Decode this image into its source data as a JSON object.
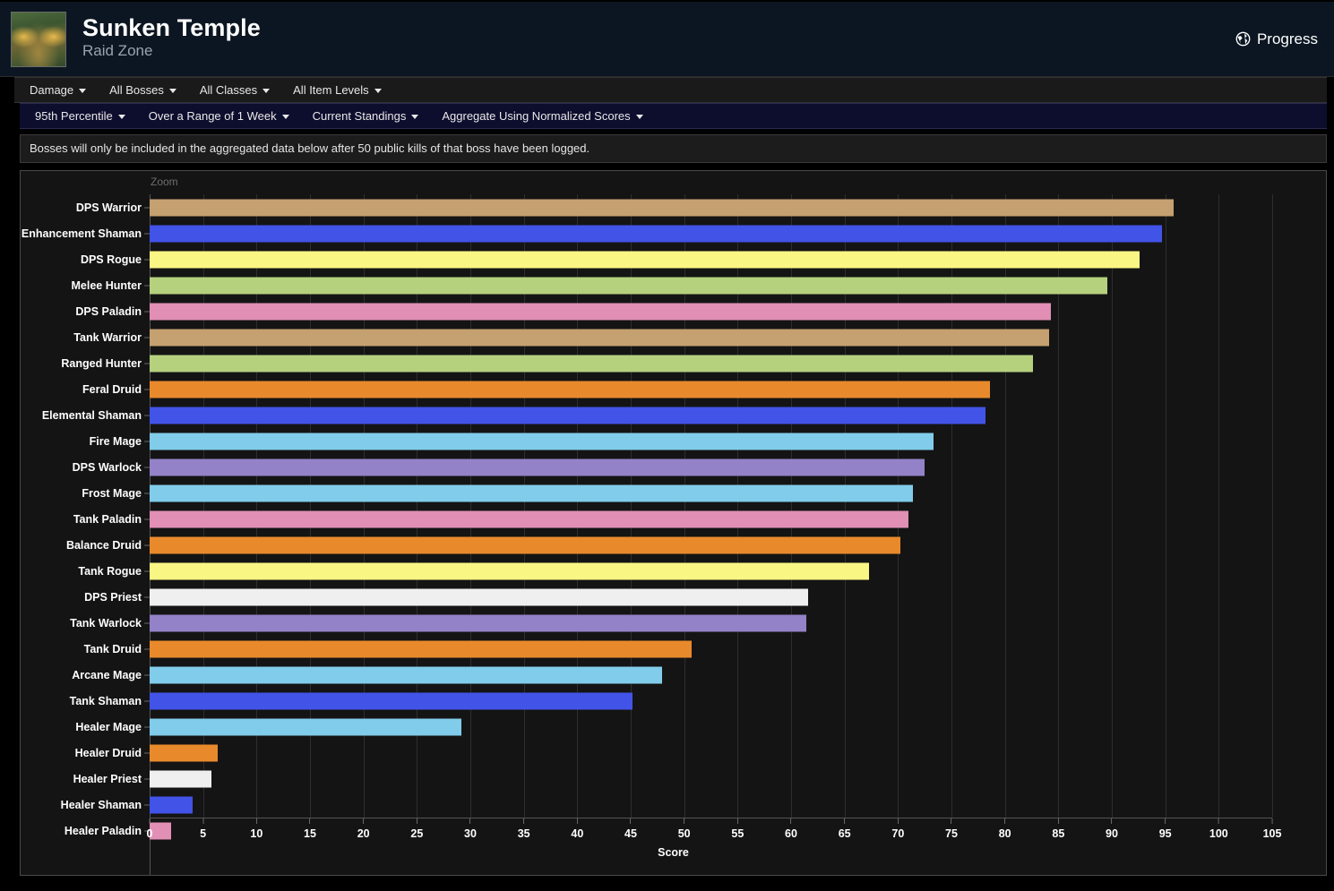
{
  "header": {
    "zone_title": "Sunken Temple",
    "zone_subtitle": "Raid Zone",
    "thumbnail_icon": "raid-zone-thumbnail",
    "progress_label": "Progress",
    "progress_icon": "globe-icon"
  },
  "filters_primary": [
    {
      "label": "Damage",
      "icon": "chevron-down-icon"
    },
    {
      "label": "All Bosses",
      "icon": "chevron-down-icon"
    },
    {
      "label": "All Classes",
      "icon": "chevron-down-icon"
    },
    {
      "label": "All Item Levels",
      "icon": "chevron-down-icon"
    }
  ],
  "filters_secondary": [
    {
      "label": "95th Percentile",
      "icon": "chevron-down-icon"
    },
    {
      "label": "Over a Range of 1 Week",
      "icon": "chevron-down-icon"
    },
    {
      "label": "Current Standings",
      "icon": "chevron-down-icon"
    },
    {
      "label": "Aggregate Using Normalized Scores",
      "icon": "chevron-down-icon"
    }
  ],
  "notice": "Bosses will only be included in the aggregated data below after 50 public kills of that boss have been logged.",
  "chart": {
    "zoom_label": "Zoom"
  },
  "chart_data": {
    "type": "bar",
    "orientation": "horizontal",
    "title": "",
    "xlabel": "Score",
    "ylabel": "",
    "xlim": [
      0,
      105
    ],
    "xticks": [
      0,
      5,
      10,
      15,
      20,
      25,
      30,
      35,
      40,
      45,
      50,
      55,
      60,
      65,
      70,
      75,
      80,
      85,
      90,
      95,
      100,
      105
    ],
    "grid": true,
    "legend": "none",
    "categories": [
      "DPS Warrior",
      "Enhancement Shaman",
      "DPS Rogue",
      "Melee Hunter",
      "DPS Paladin",
      "Tank Warrior",
      "Ranged Hunter",
      "Feral Druid",
      "Elemental Shaman",
      "Fire Mage",
      "DPS Warlock",
      "Frost Mage",
      "Tank Paladin",
      "Balance Druid",
      "Tank Rogue",
      "DPS Priest",
      "Tank Warlock",
      "Tank Druid",
      "Arcane Mage",
      "Tank Shaman",
      "Healer Mage",
      "Healer Druid",
      "Healer Priest",
      "Healer Shaman",
      "Healer Paladin"
    ],
    "values": [
      95.8,
      94.7,
      92.6,
      89.6,
      84.3,
      84.1,
      82.6,
      78.6,
      78.2,
      73.3,
      72.5,
      71.4,
      71.0,
      70.2,
      67.3,
      61.6,
      61.4,
      50.7,
      47.9,
      45.2,
      29.2,
      6.4,
      5.8,
      4.0,
      2.0
    ],
    "colors": [
      "#c5a070",
      "#4253e8",
      "#faf684",
      "#b5d17e",
      "#e18fb4",
      "#c5a070",
      "#b5d17e",
      "#e88a2c",
      "#4253e8",
      "#81ccea",
      "#9382c8",
      "#81ccea",
      "#e18fb4",
      "#e88a2c",
      "#faf684",
      "#efefef",
      "#9382c8",
      "#e88a2c",
      "#81ccea",
      "#4253e8",
      "#81ccea",
      "#e88a2c",
      "#efefef",
      "#4253e8",
      "#e18fb4"
    ]
  }
}
